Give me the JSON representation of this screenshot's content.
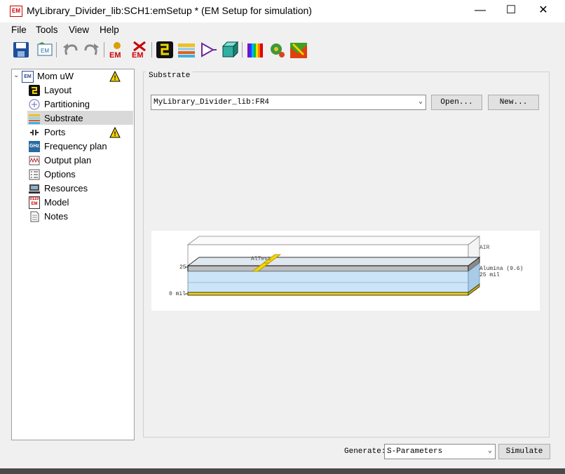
{
  "window": {
    "app_icon_text": "EM",
    "title": "MyLibrary_Divider_lib:SCH1:emSetup * (EM Setup for simulation)",
    "minimize": "—",
    "maximize": "☐",
    "close": "✕"
  },
  "menu": {
    "file": "File",
    "tools": "Tools",
    "view": "View",
    "help": "Help"
  },
  "toolbar": {
    "icons": [
      "save-icon",
      "open-em-icon",
      "undo-icon",
      "redo-icon",
      "em-simulate-icon",
      "em-stop-icon",
      "layout-icon",
      "substrate-icon",
      "port-icon",
      "box-3d-icon",
      "spectrum-icon",
      "gear-3d-icon",
      "visualization-icon"
    ],
    "em_label": "EM"
  },
  "tree": {
    "root": {
      "label": "Mom uW",
      "icon": "em-icon",
      "warning": true
    },
    "items": [
      {
        "label": "Layout",
        "icon": "layout-icon"
      },
      {
        "label": "Partitioning",
        "icon": "partitioning-icon"
      },
      {
        "label": "Substrate",
        "icon": "substrate-icon",
        "selected": true
      },
      {
        "label": "Ports",
        "icon": "ports-icon",
        "warning": true
      },
      {
        "label": "Frequency plan",
        "icon": "ghz-icon",
        "icon_text": "GHz"
      },
      {
        "label": "Output plan",
        "icon": "output-plan-icon"
      },
      {
        "label": "Options",
        "icon": "options-icon"
      },
      {
        "label": "Resources",
        "icon": "resources-icon"
      },
      {
        "label": "Model",
        "icon": "model-icon",
        "icon_text": "0110\nEM"
      },
      {
        "label": "Notes",
        "icon": "notes-icon"
      }
    ]
  },
  "substrate": {
    "group_label": "Substrate",
    "selected_substrate": "MyLibrary_Divider_lib:FR4",
    "open_button": "Open...",
    "new_button": "New...",
    "preview": {
      "labels": {
        "air": "AIR",
        "alumina": "Alumina (9.6)",
        "thickness": "25 mil",
        "top_tick": "25",
        "bottom_tick": "0 mil",
        "trace": "AlTest"
      },
      "colors": {
        "substrate": "#cce4f7",
        "metal": "#f2d500",
        "dark": "#333333"
      }
    }
  },
  "bottom": {
    "generate_label": "Generate:",
    "generate_value": "S-Parameters",
    "simulate_button": "Simulate"
  }
}
